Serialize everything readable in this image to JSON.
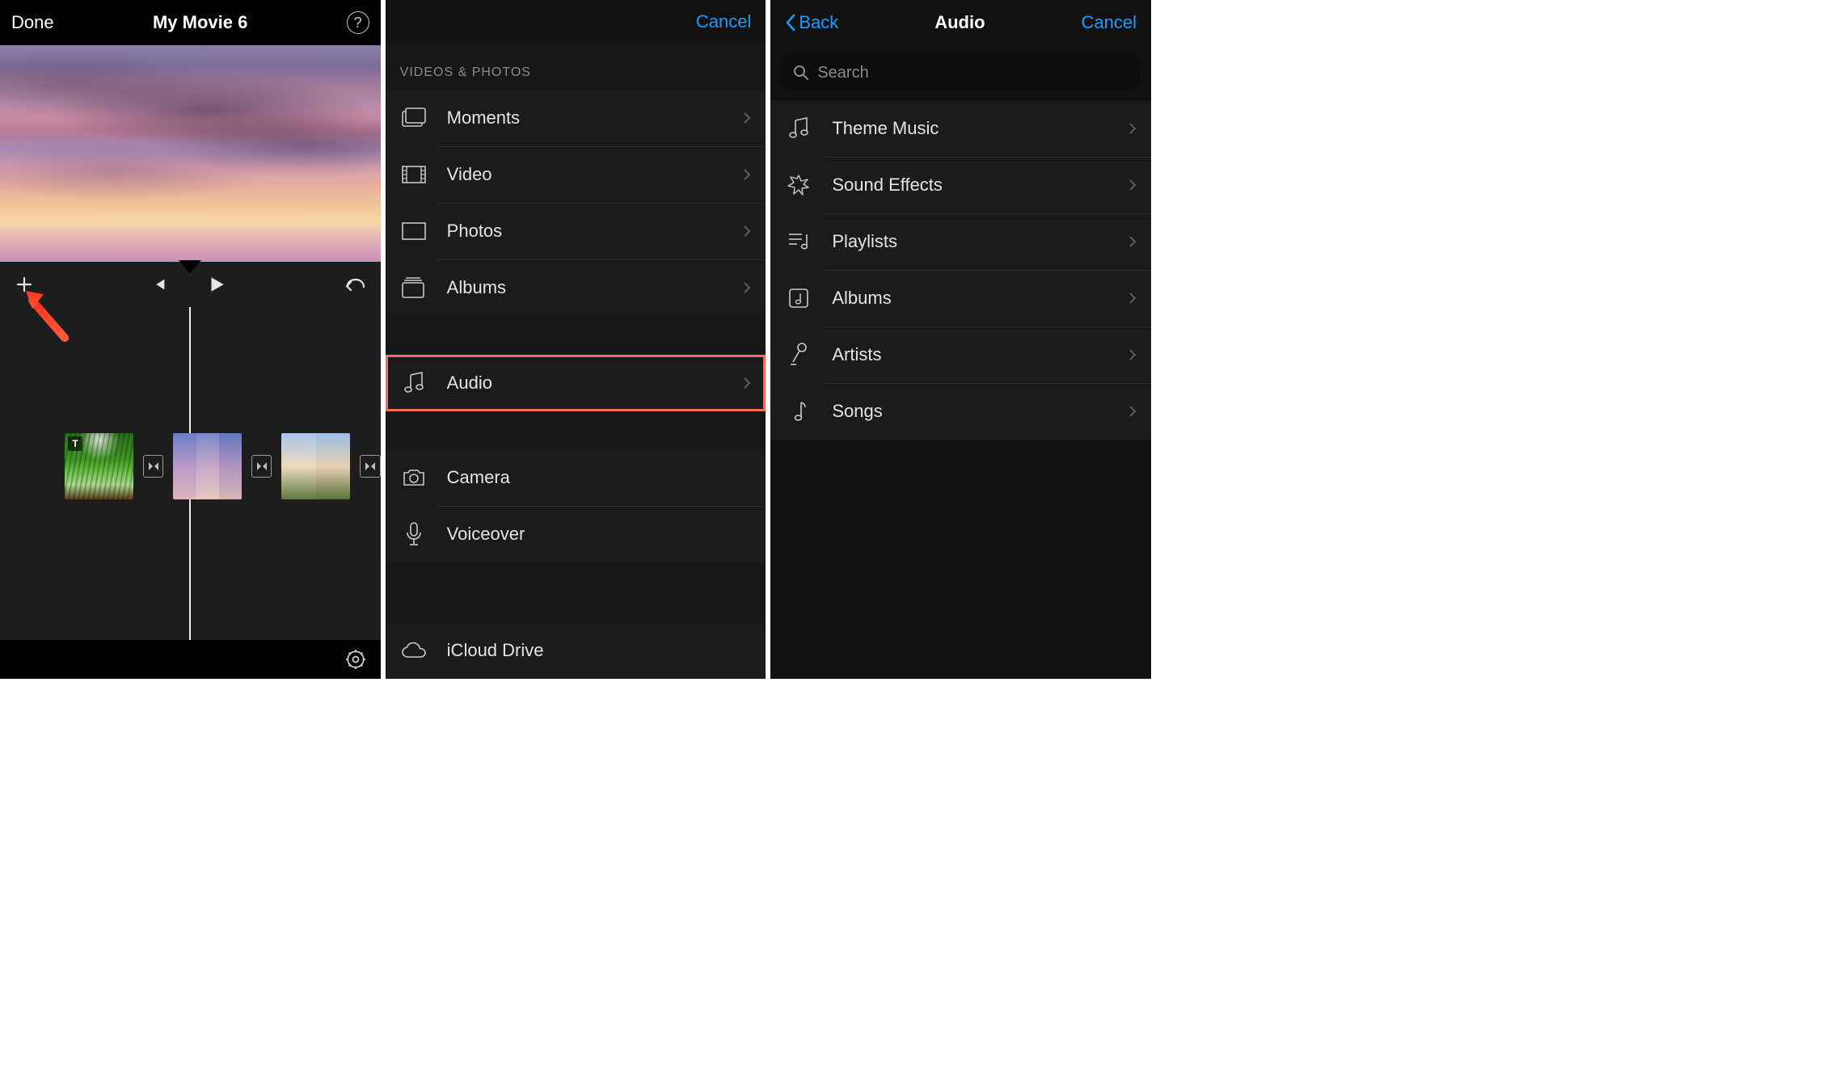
{
  "panel1": {
    "done_label": "Done",
    "title": "My Movie 6",
    "help_label": "?",
    "clip_badge_text": "T"
  },
  "panel2": {
    "cancel_label": "Cancel",
    "section_label": "VIDEOS & PHOTOS",
    "rows_group1": [
      {
        "label": "Moments",
        "icon": "moments"
      },
      {
        "label": "Video",
        "icon": "video"
      },
      {
        "label": "Photos",
        "icon": "photos"
      },
      {
        "label": "Albums",
        "icon": "albums"
      }
    ],
    "audio_row": {
      "label": "Audio",
      "icon": "audio"
    },
    "rows_group3": [
      {
        "label": "Camera",
        "icon": "camera"
      },
      {
        "label": "Voiceover",
        "icon": "voiceover"
      }
    ],
    "rows_group4": [
      {
        "label": "iCloud Drive",
        "icon": "icloud"
      }
    ]
  },
  "panel3": {
    "back_label": "Back",
    "title": "Audio",
    "cancel_label": "Cancel",
    "search_placeholder": "Search",
    "rows": [
      {
        "label": "Theme Music",
        "icon": "theme-music"
      },
      {
        "label": "Sound Effects",
        "icon": "sound-effects"
      },
      {
        "label": "Playlists",
        "icon": "playlists"
      },
      {
        "label": "Albums",
        "icon": "album-disc"
      },
      {
        "label": "Artists",
        "icon": "artists"
      },
      {
        "label": "Songs",
        "icon": "songs"
      }
    ]
  }
}
